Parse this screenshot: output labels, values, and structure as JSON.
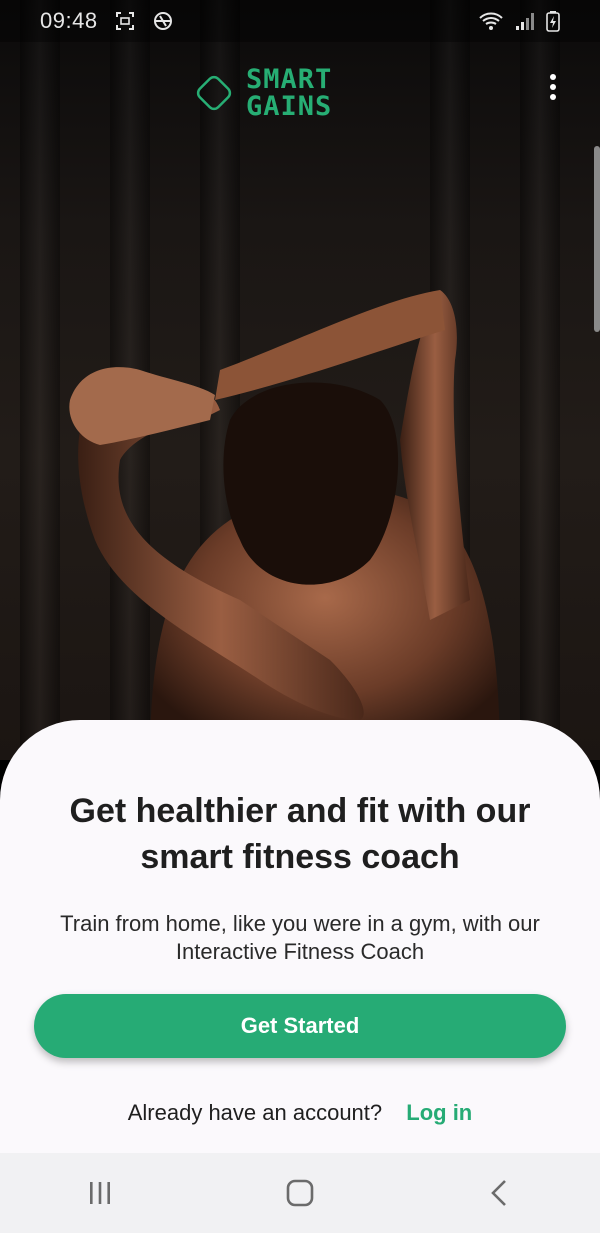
{
  "status_bar": {
    "time": "09:48",
    "left_icons": [
      "screenshot-icon",
      "sync-icon"
    ],
    "right_icons": [
      "wifi-icon",
      "signal-icon",
      "battery-charging-icon"
    ]
  },
  "header": {
    "logo_line1": "SMART",
    "logo_line2": "GAINS",
    "brand_color": "#27ae74",
    "menu_icon": "more-vert-icon"
  },
  "hero": {
    "image": "athlete-stretching-photo"
  },
  "sheet": {
    "headline": "Get healthier and fit with our smart fitness coach",
    "subline": "Train from home, like you were in a gym, with our Interactive Fitness Coach",
    "cta_label": "Get Started",
    "cta_color": "#26ab75",
    "login_prompt": "Already have an account?",
    "login_link": "Log in"
  },
  "nav_bar": {
    "icons": [
      "recent-apps-icon",
      "home-icon",
      "back-icon"
    ]
  }
}
